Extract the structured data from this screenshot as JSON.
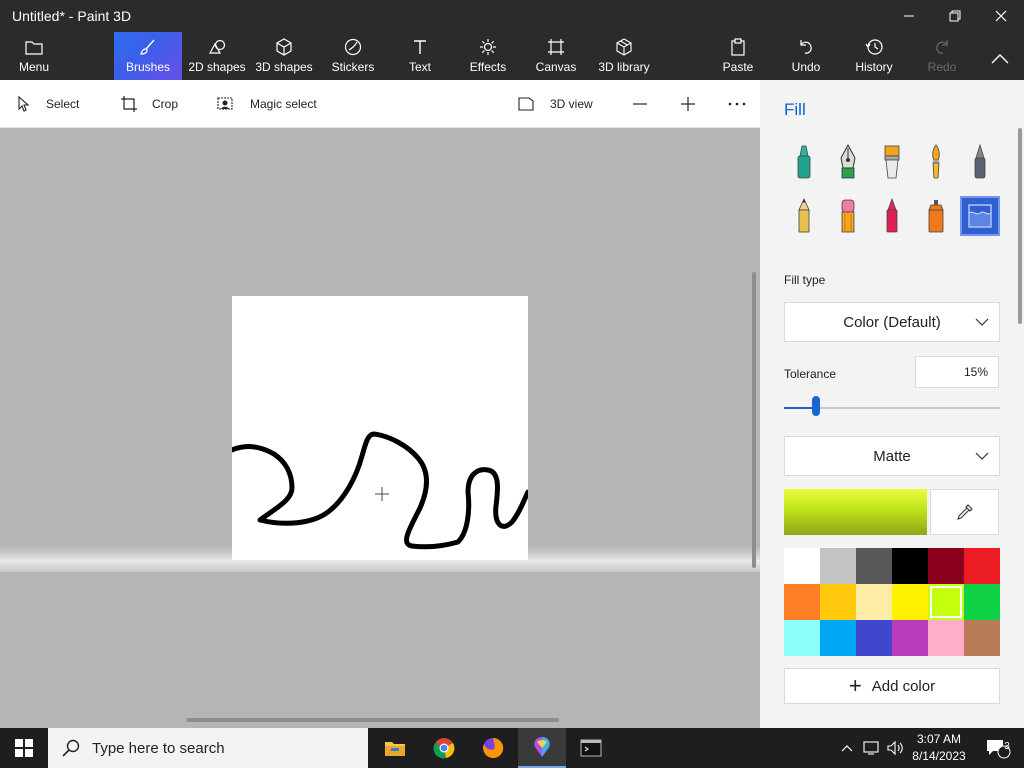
{
  "window": {
    "title": "Untitled* - Paint 3D"
  },
  "ribbon": {
    "menu": "Menu",
    "brushes": "Brushes",
    "shapes2d": "2D shapes",
    "shapes3d": "3D shapes",
    "stickers": "Stickers",
    "text": "Text",
    "effects": "Effects",
    "canvas": "Canvas",
    "library3d": "3D library",
    "paste": "Paste",
    "undo": "Undo",
    "history": "History",
    "redo": "Redo"
  },
  "toolbar": {
    "select": "Select",
    "crop": "Crop",
    "magic_select": "Magic select",
    "view3d": "3D view"
  },
  "panel": {
    "title": "Fill",
    "fill_type_label": "Fill type",
    "fill_type_value": "Color (Default)",
    "tolerance_label": "Tolerance",
    "tolerance_value": "15%",
    "tolerance_fraction": 0.15,
    "finish_value": "Matte",
    "add_color": "Add color",
    "current_color": "#c3e41d",
    "palette": [
      "#ffffff",
      "#c3c3c3",
      "#585858",
      "#000000",
      "#88001b",
      "#ec1c24",
      "#ff7f27",
      "#ffc90e",
      "#fdeca6",
      "#fff200",
      "#c4ff0e",
      "#0ed145",
      "#8cfffb",
      "#00a8f3",
      "#3f48cc",
      "#b83dba",
      "#ffaec8",
      "#b97a56"
    ],
    "brushes": [
      "marker-icon",
      "calligraphy-pen-icon",
      "oil-brush-icon",
      "watercolor-icon",
      "pixel-pen-icon",
      "pencil-icon",
      "eraser-icon",
      "crayon-icon",
      "spray-can-icon",
      "fill-bucket-icon"
    ]
  },
  "taskbar": {
    "search_placeholder": "Type here to search",
    "time": "3:07 AM",
    "date": "8/14/2023",
    "notifications": "3"
  }
}
